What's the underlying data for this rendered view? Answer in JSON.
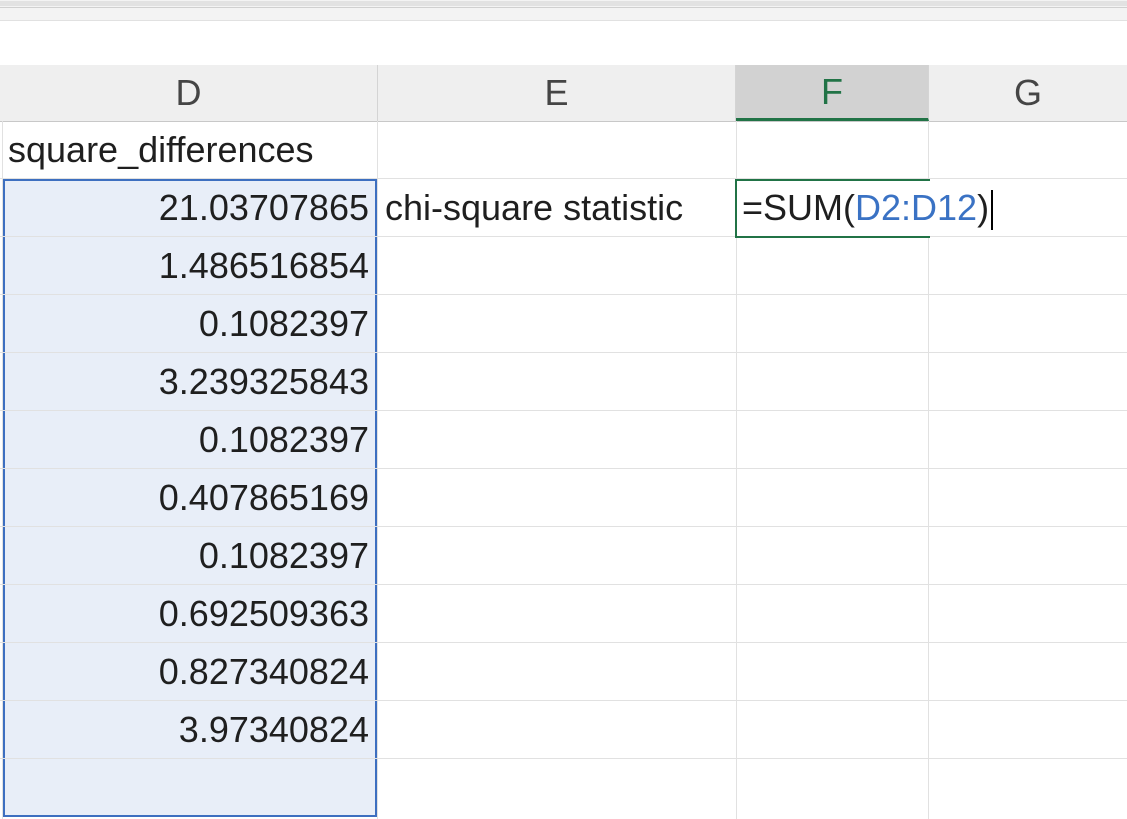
{
  "columns": [
    {
      "label": "D"
    },
    {
      "label": "E"
    },
    {
      "label": "F"
    },
    {
      "label": "G"
    }
  ],
  "cells": {
    "d1": "square_differences",
    "d_values": [
      "21.03707865",
      "1.486516854",
      "0.1082397",
      "3.239325843",
      "0.1082397",
      "0.407865169",
      "0.1082397",
      "0.692509363",
      "0.827340824",
      "3.97340824"
    ],
    "e2": "chi-square statistic"
  },
  "formula": {
    "prefix": "=SUM(",
    "range": "D2:D12",
    "suffix": ")"
  },
  "colors": {
    "selection_fill": "#e8eef8",
    "selection_border": "#3d6fc0",
    "active_accent": "#217346",
    "range_ref": "#3a72c4"
  }
}
